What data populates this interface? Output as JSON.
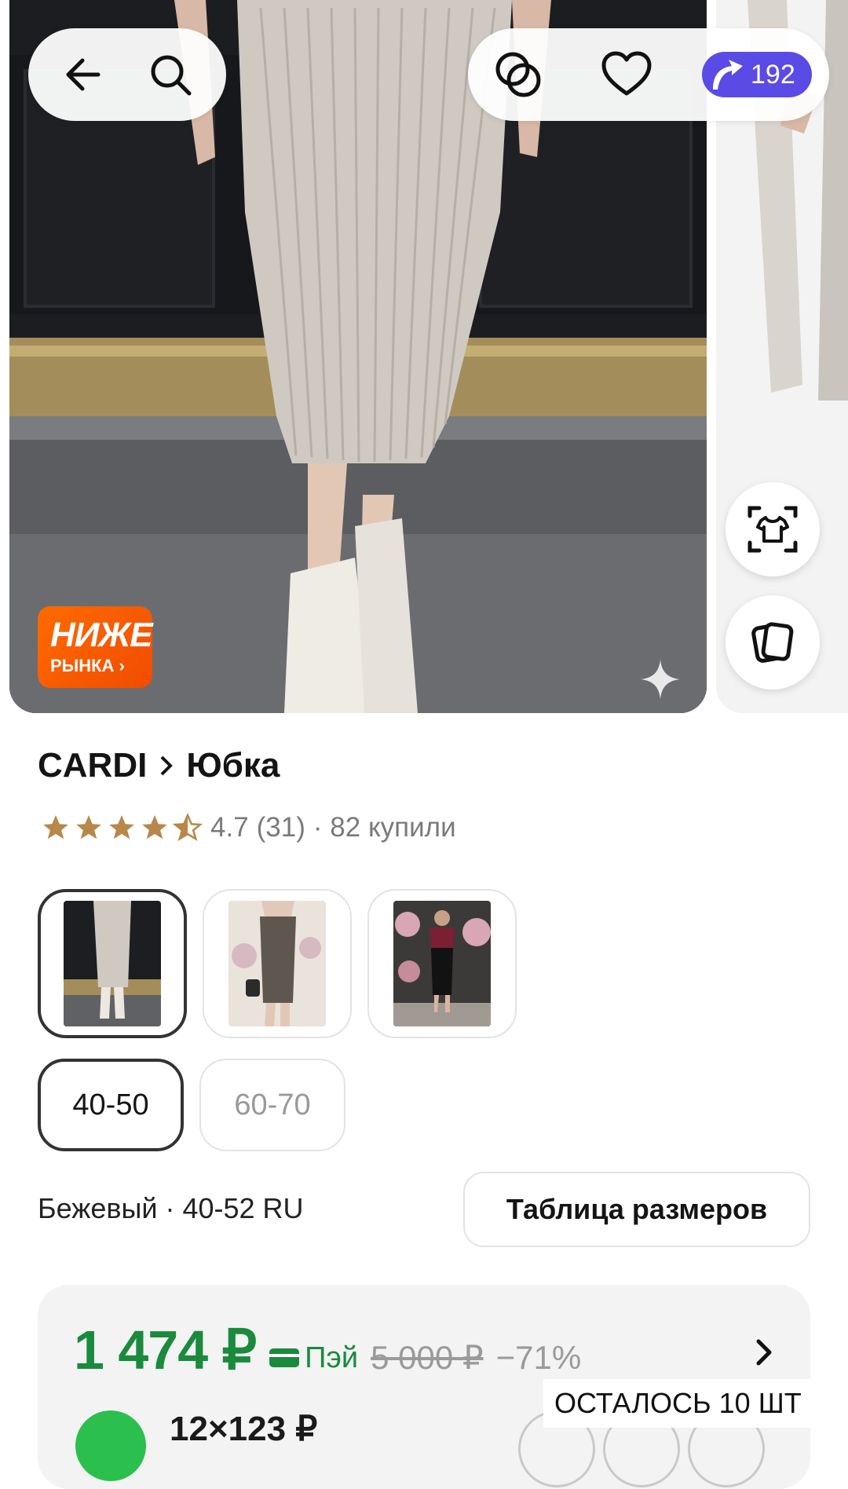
{
  "toolbar": {
    "cashback_value": "192"
  },
  "badge": {
    "line1": "НИЖЕ",
    "line2": "РЫНКА"
  },
  "product": {
    "brand": "CARDI",
    "category": "Юбка",
    "rating": "4.7",
    "reviews": "(31)",
    "bought": "· 82 купили",
    "stars_value": 4.5
  },
  "variants": {
    "sizes": [
      {
        "label": "40-50",
        "selected": true
      },
      {
        "label": "60-70",
        "selected": false
      }
    ]
  },
  "spec": {
    "text": "Бежевый · 40-52 RU",
    "size_table_label": "Таблица размеров"
  },
  "price": {
    "current": "1 474 ₽",
    "pay_label": "Пэй",
    "old": "5 000 ₽",
    "discount": "−71%",
    "installment": "12×123 ₽",
    "stock": "ОСТАЛОСЬ 10 ШТ"
  },
  "colors": {
    "accent_green": "#1a8a3d",
    "cashback_purple": "#5a4ae6",
    "badge_orange": "#ff6a00"
  }
}
